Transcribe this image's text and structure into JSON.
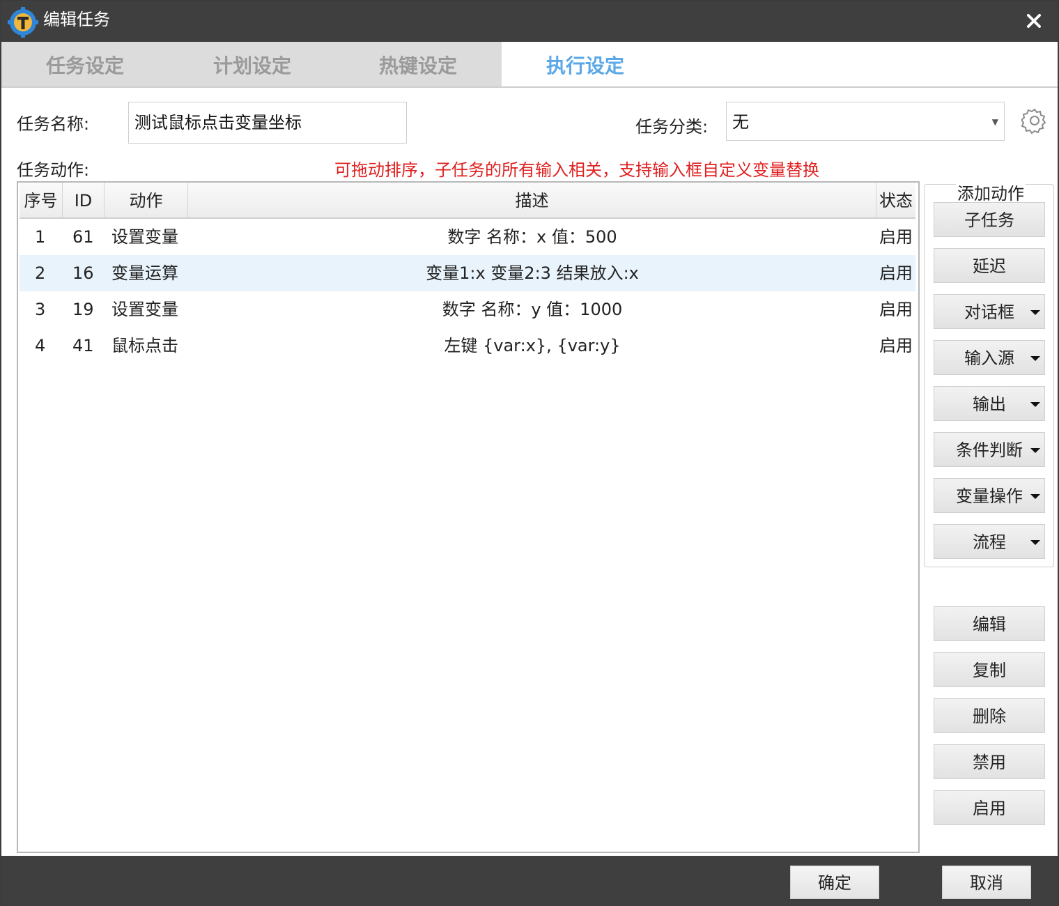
{
  "window": {
    "title": "编辑任务"
  },
  "tabs": [
    {
      "label": "任务设定",
      "active": false
    },
    {
      "label": "计划设定",
      "active": false
    },
    {
      "label": "热键设定",
      "active": false
    },
    {
      "label": "执行设定",
      "active": true
    }
  ],
  "form": {
    "task_name_label": "任务名称:",
    "task_name_value": "测试鼠标点击变量坐标",
    "category_label": "任务分类:",
    "category_value": "无",
    "actions_label": "任务动作:",
    "hint": "可拖动排序，子任务的所有输入相关，支持输入框自定义变量替换"
  },
  "table": {
    "columns": [
      "序号",
      "ID",
      "动作",
      "描述",
      "状态"
    ],
    "rows": [
      {
        "index": "1",
        "id": "61",
        "action": "设置变量",
        "desc": "数字 名称：x 值：500",
        "status": "启用",
        "selected": false
      },
      {
        "index": "2",
        "id": "16",
        "action": "变量运算",
        "desc": "变量1:x 变量2:3 结果放入:x",
        "status": "启用",
        "selected": true
      },
      {
        "index": "3",
        "id": "19",
        "action": "设置变量",
        "desc": "数字 名称：y 值：1000",
        "status": "启用",
        "selected": false
      },
      {
        "index": "4",
        "id": "41",
        "action": "鼠标点击",
        "desc": "左键 {var:x}, {var:y}",
        "status": "启用",
        "selected": false
      }
    ]
  },
  "add_action": {
    "title": "添加动作",
    "buttons": [
      {
        "label": "子任务",
        "dropdown": false
      },
      {
        "label": "延迟",
        "dropdown": false
      },
      {
        "label": "对话框",
        "dropdown": true
      },
      {
        "label": "输入源",
        "dropdown": true
      },
      {
        "label": "输出",
        "dropdown": true
      },
      {
        "label": "条件判断",
        "dropdown": true
      },
      {
        "label": "变量操作",
        "dropdown": true
      },
      {
        "label": "流程",
        "dropdown": true
      }
    ]
  },
  "edit_buttons": [
    "编辑",
    "复制",
    "删除",
    "禁用",
    "启用"
  ],
  "footer": {
    "ok": "确定",
    "cancel": "取消"
  },
  "colors": {
    "titlebar": "#3f3f3f",
    "active_tab": "#5aa8e8",
    "hint": "#e02020",
    "selected_row": "#e8f3fc"
  }
}
